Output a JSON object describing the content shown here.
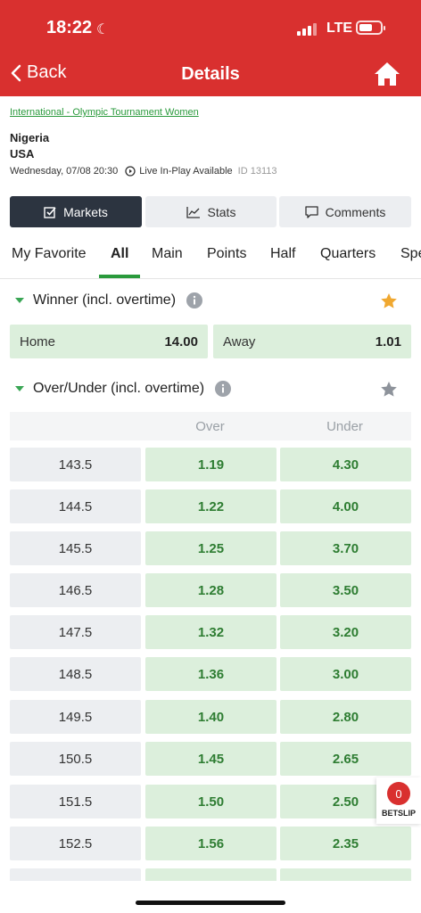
{
  "status_bar": {
    "time": "18:22",
    "network": "LTE"
  },
  "nav": {
    "back_label": "Back",
    "title": "Details"
  },
  "event": {
    "league": "International - Olympic Tournament Women",
    "team_home": "Nigeria",
    "team_away": "USA",
    "date_time": "Wednesday, 07/08  20:30",
    "live_label": "Live In-Play Available",
    "event_id": "ID 13113"
  },
  "segments": {
    "markets": "Markets",
    "stats": "Stats",
    "comments": "Comments"
  },
  "tabs": [
    "My Favorite",
    "All",
    "Main",
    "Points",
    "Half",
    "Quarters",
    "Spe"
  ],
  "active_tab": "All",
  "winner_market": {
    "title": "Winner (incl. overtime)",
    "favorited": true,
    "home_label": "Home",
    "home_odds": "14.00",
    "away_label": "Away",
    "away_odds": "1.01"
  },
  "ou_market": {
    "title": "Over/Under (incl. overtime)",
    "favorited": false,
    "col_over": "Over",
    "col_under": "Under",
    "rows": [
      {
        "line": "143.5",
        "over": "1.19",
        "under": "4.30"
      },
      {
        "line": "144.5",
        "over": "1.22",
        "under": "4.00"
      },
      {
        "line": "145.5",
        "over": "1.25",
        "under": "3.70"
      },
      {
        "line": "146.5",
        "over": "1.28",
        "under": "3.50"
      },
      {
        "line": "147.5",
        "over": "1.32",
        "under": "3.20"
      },
      {
        "line": "148.5",
        "over": "1.36",
        "under": "3.00"
      },
      {
        "line": "149.5",
        "over": "1.40",
        "under": "2.80"
      },
      {
        "line": "150.5",
        "over": "1.45",
        "under": "2.65"
      },
      {
        "line": "151.5",
        "over": "1.50",
        "under": "2.50"
      },
      {
        "line": "152.5",
        "over": "1.56",
        "under": "2.35"
      }
    ]
  },
  "betslip": {
    "count": "0",
    "label": "BETSLIP"
  },
  "colors": {
    "brand_red": "#d9302f",
    "accent_green": "#2a9a3c",
    "odds_bg": "#dcefdc",
    "star_gold": "#f0a830"
  }
}
